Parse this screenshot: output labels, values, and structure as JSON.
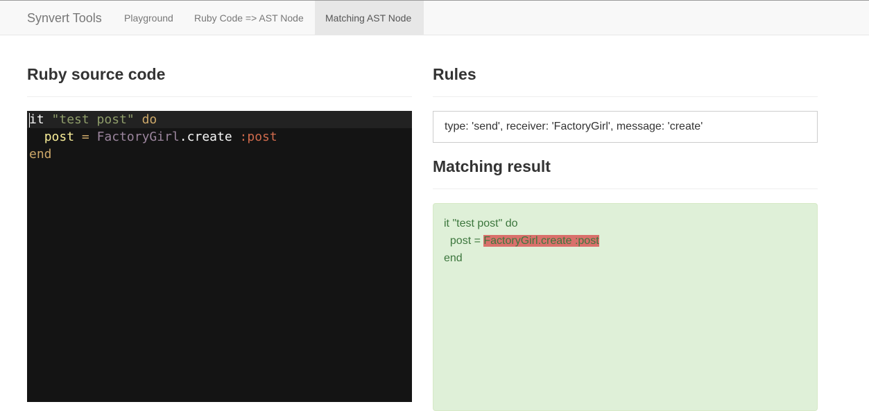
{
  "navbar": {
    "brand": "Synvert Tools",
    "items": [
      {
        "label": "Playground"
      },
      {
        "label": "Ruby Code => AST Node"
      },
      {
        "label": "Matching AST Node",
        "active": true
      }
    ]
  },
  "left": {
    "heading": "Ruby source code",
    "code": {
      "line1": {
        "kw1": "it",
        "str": "\"test post\"",
        "kw2": "do"
      },
      "line2": {
        "indent": "  ",
        "var": "post",
        "eq": "=",
        "const": "FactoryGirl",
        "dot": ".",
        "method": "create",
        "sym": ":post"
      },
      "line3": {
        "kw": "end"
      }
    }
  },
  "right": {
    "rules_heading": "Rules",
    "rules_value": "type: 'send', receiver: 'FactoryGirl', message: 'create'",
    "result_heading": "Matching result",
    "result": {
      "line1": "it \"test post\" do",
      "line2_prefix": "  post = ",
      "line2_match": "FactoryGirl.create :post",
      "line3": "end"
    }
  },
  "colors": {
    "editor_bg": "#141414",
    "result_bg": "#dff0d8",
    "result_text": "#3c763d",
    "highlight": "#d9706b"
  }
}
